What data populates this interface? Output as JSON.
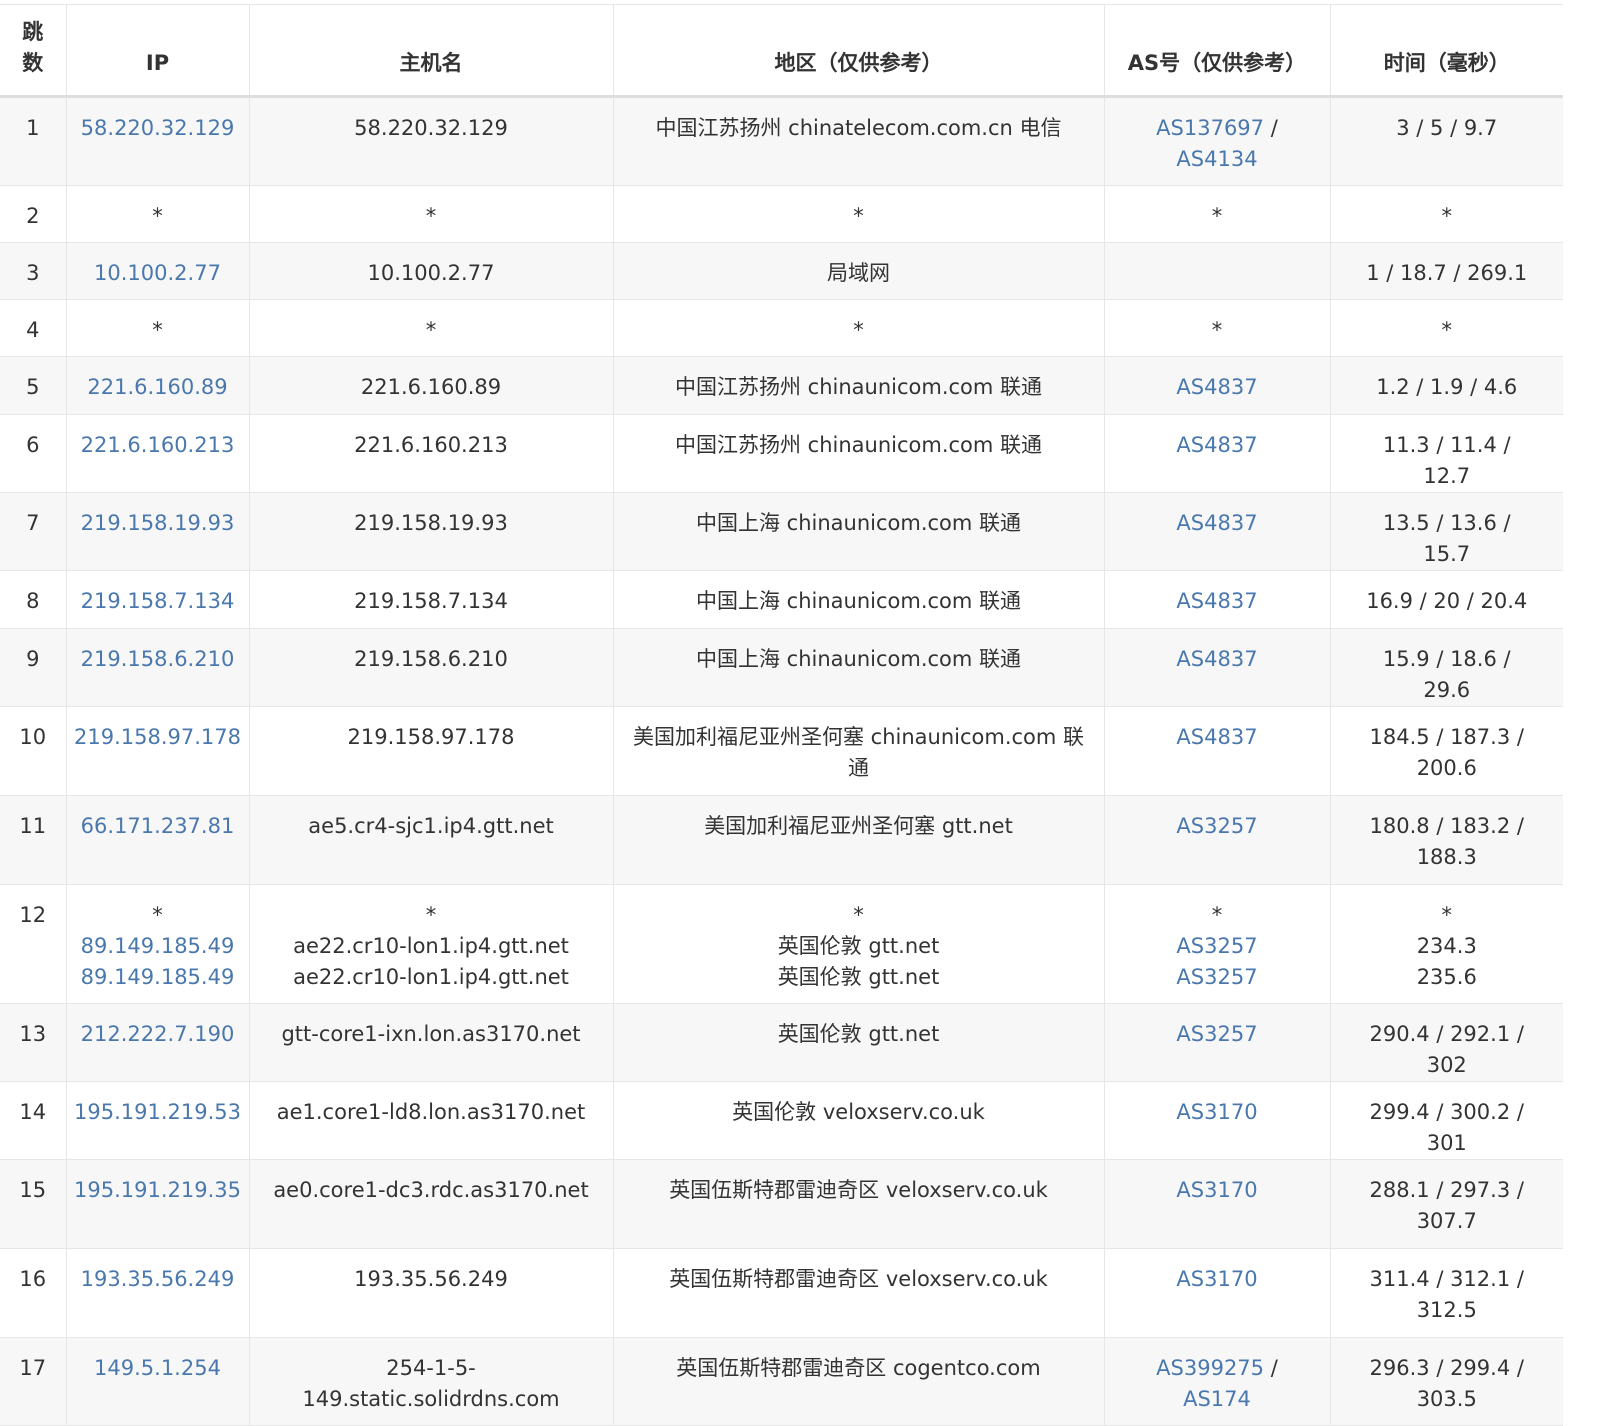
{
  "table": {
    "headers": {
      "hop": "跳数",
      "ip": "IP",
      "hostname": "主机名",
      "region": "地区（仅供参考）",
      "asn": "AS号（仅供参考）",
      "time": "时间（毫秒）"
    },
    "rows": [
      {
        "hop": "1",
        "ip": [
          "58.220.32.129"
        ],
        "hostname": [
          "58.220.32.129"
        ],
        "region": [
          "中国江苏扬州 chinatelecom.com.cn 电信"
        ],
        "asn": [
          [
            "AS137697",
            "AS4134"
          ]
        ],
        "time": [
          "3 / 5 / 9.7"
        ]
      },
      {
        "hop": "2",
        "ip": [
          "*"
        ],
        "hostname": [
          "*"
        ],
        "region": [
          "*"
        ],
        "asn": [
          [
            "*"
          ]
        ],
        "time": [
          "*"
        ]
      },
      {
        "hop": "3",
        "ip": [
          "10.100.2.77"
        ],
        "hostname": [
          "10.100.2.77"
        ],
        "region": [
          "局域网"
        ],
        "asn": [],
        "time": [
          "1 / 18.7 / 269.1"
        ]
      },
      {
        "hop": "4",
        "ip": [
          "*"
        ],
        "hostname": [
          "*"
        ],
        "region": [
          "*"
        ],
        "asn": [
          [
            "*"
          ]
        ],
        "time": [
          "*"
        ]
      },
      {
        "hop": "5",
        "ip": [
          "221.6.160.89"
        ],
        "hostname": [
          "221.6.160.89"
        ],
        "region": [
          "中国江苏扬州 chinaunicom.com 联通"
        ],
        "asn": [
          [
            "AS4837"
          ]
        ],
        "time": [
          "1.2 / 1.9 / 4.6"
        ]
      },
      {
        "hop": "6",
        "ip": [
          "221.6.160.213"
        ],
        "hostname": [
          "221.6.160.213"
        ],
        "region": [
          "中国江苏扬州 chinaunicom.com 联通"
        ],
        "asn": [
          [
            "AS4837"
          ]
        ],
        "time": [
          "11.3 / 11.4 / 12.7"
        ]
      },
      {
        "hop": "7",
        "ip": [
          "219.158.19.93"
        ],
        "hostname": [
          "219.158.19.93"
        ],
        "region": [
          "中国上海 chinaunicom.com 联通"
        ],
        "asn": [
          [
            "AS4837"
          ]
        ],
        "time": [
          "13.5 / 13.6 / 15.7"
        ]
      },
      {
        "hop": "8",
        "ip": [
          "219.158.7.134"
        ],
        "hostname": [
          "219.158.7.134"
        ],
        "region": [
          "中国上海 chinaunicom.com 联通"
        ],
        "asn": [
          [
            "AS4837"
          ]
        ],
        "time": [
          "16.9 / 20 / 20.4"
        ]
      },
      {
        "hop": "9",
        "ip": [
          "219.158.6.210"
        ],
        "hostname": [
          "219.158.6.210"
        ],
        "region": [
          "中国上海 chinaunicom.com 联通"
        ],
        "asn": [
          [
            "AS4837"
          ]
        ],
        "time": [
          "15.9 / 18.6 / 29.6"
        ]
      },
      {
        "hop": "10",
        "ip": [
          "219.158.97.178"
        ],
        "hostname": [
          "219.158.97.178"
        ],
        "region": [
          "美国加利福尼亚州圣何塞 chinaunicom.com 联通"
        ],
        "asn": [
          [
            "AS4837"
          ]
        ],
        "time": [
          "184.5 / 187.3 / 200.6"
        ]
      },
      {
        "hop": "11",
        "ip": [
          "66.171.237.81"
        ],
        "hostname": [
          "ae5.cr4-sjc1.ip4.gtt.net"
        ],
        "region": [
          "美国加利福尼亚州圣何塞 gtt.net"
        ],
        "asn": [
          [
            "AS3257"
          ]
        ],
        "time": [
          "180.8 / 183.2 / 188.3"
        ]
      },
      {
        "hop": "12",
        "ip": [
          "*",
          "89.149.185.49",
          "89.149.185.49"
        ],
        "hostname": [
          "*",
          "ae22.cr10-lon1.ip4.gtt.net",
          "ae22.cr10-lon1.ip4.gtt.net"
        ],
        "region": [
          "*",
          "英国伦敦 gtt.net",
          "英国伦敦 gtt.net"
        ],
        "asn": [
          [
            "*"
          ],
          [
            "AS3257"
          ],
          [
            "AS3257"
          ]
        ],
        "time": [
          "*",
          "234.3",
          "235.6"
        ]
      },
      {
        "hop": "13",
        "ip": [
          "212.222.7.190"
        ],
        "hostname": [
          "gtt-core1-ixn.lon.as3170.net"
        ],
        "region": [
          "英国伦敦 gtt.net"
        ],
        "asn": [
          [
            "AS3257"
          ]
        ],
        "time": [
          "290.4 / 292.1 / 302"
        ]
      },
      {
        "hop": "14",
        "ip": [
          "195.191.219.53"
        ],
        "hostname": [
          "ae1.core1-ld8.lon.as3170.net"
        ],
        "region": [
          "英国伦敦 veloxserv.co.uk"
        ],
        "asn": [
          [
            "AS3170"
          ]
        ],
        "time": [
          "299.4 / 300.2 / 301"
        ]
      },
      {
        "hop": "15",
        "ip": [
          "195.191.219.35"
        ],
        "hostname": [
          "ae0.core1-dc3.rdc.as3170.net"
        ],
        "region": [
          "英国伍斯特郡雷迪奇区 veloxserv.co.uk"
        ],
        "asn": [
          [
            "AS3170"
          ]
        ],
        "time": [
          "288.1 / 297.3 / 307.7"
        ]
      },
      {
        "hop": "16",
        "ip": [
          "193.35.56.249"
        ],
        "hostname": [
          "193.35.56.249"
        ],
        "region": [
          "英国伍斯特郡雷迪奇区 veloxserv.co.uk"
        ],
        "asn": [
          [
            "AS3170"
          ]
        ],
        "time": [
          "311.4 / 312.1 / 312.5"
        ]
      },
      {
        "hop": "17",
        "ip": [
          "149.5.1.254"
        ],
        "hostname": [
          "254-1-5-149.static.solidrdns.com"
        ],
        "region": [
          "英国伍斯特郡雷迪奇区 cogentco.com"
        ],
        "asn": [
          [
            "AS399275",
            "AS174"
          ]
        ],
        "time": [
          "296.3 / 299.4 / 303.5"
        ]
      }
    ]
  }
}
